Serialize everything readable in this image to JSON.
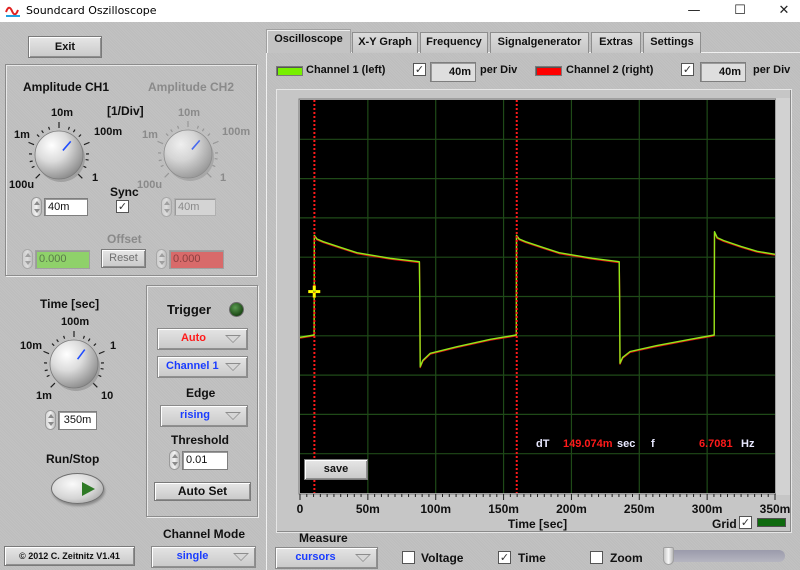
{
  "window": {
    "title": "Soundcard Oszilloscope",
    "minimize_glyph": "—",
    "maximize_glyph": "☐",
    "close_glyph": "✕"
  },
  "left": {
    "exit_label": "Exit",
    "amplitude": {
      "ch1_title": "Amplitude CH1",
      "ch2_title": "Amplitude CH2",
      "unit_label": "[1/Div]",
      "ch1_knob": {
        "scale": [
          "100u",
          "1m",
          "10m",
          "100m",
          "1"
        ],
        "value": "40m",
        "value_num": 0.04,
        "min": 0.0001,
        "max": 1,
        "enabled": true
      },
      "ch2_knob": {
        "scale": [
          "100u",
          "1m",
          "10m",
          "100m",
          "1"
        ],
        "value": "40m",
        "value_num": 0.04,
        "min": 0.0001,
        "max": 1,
        "enabled": false
      },
      "sync_label": "Sync",
      "sync_checked": true,
      "offset_label": "Offset",
      "offset_ch1": "0.000",
      "offset_ch2": "0.000",
      "reset_label": "Reset"
    },
    "time": {
      "title": "Time [sec]",
      "knob": {
        "scale": [
          "1m",
          "10m",
          "100m",
          "1",
          "10"
        ],
        "value": "350m",
        "value_num": 0.35,
        "min": 0.001,
        "max": 10
      }
    },
    "run_stop_label": "Run/Stop",
    "copyright": "© 2012  C. Zeitnitz V1.41",
    "trigger": {
      "title": "Trigger",
      "mode": "Auto",
      "mode_color": "#ff1a1a",
      "source": "Channel 1",
      "source_color": "#1a3cff",
      "edge_label": "Edge",
      "edge": "rising",
      "threshold_label": "Threshold",
      "threshold": "0.01",
      "auto_set_label": "Auto Set",
      "led_state": "off"
    },
    "channel_mode": {
      "label": "Channel Mode",
      "value": "single"
    }
  },
  "tabs": [
    {
      "label": "Oscilloscope",
      "active": true
    },
    {
      "label": "X-Y Graph",
      "active": false
    },
    {
      "label": "Frequency",
      "active": false
    },
    {
      "label": "Signalgenerator",
      "active": false
    },
    {
      "label": "Extras",
      "active": false
    },
    {
      "label": "Settings",
      "active": false
    }
  ],
  "channels": [
    {
      "label": "Channel 1 (left)",
      "color": "#78f000",
      "enabled": true,
      "per_div": "40m"
    },
    {
      "label": "Channel 2 (right)",
      "color": "#ff0000",
      "enabled": true,
      "per_div": "40m"
    }
  ],
  "per_div_label": "per Div",
  "scope": {
    "save_label": "save",
    "dT_label": "dT",
    "dT_value": "149.074m",
    "dT_unit": "sec",
    "f_label": "f",
    "f_value": "6.7081",
    "f_unit": "Hz",
    "grid_label": "Grid",
    "grid_checked": true,
    "grid_color": "#0e6a0e"
  },
  "measure": {
    "label": "Measure",
    "mode": "cursors",
    "voltage_label": "Voltage",
    "voltage_checked": false,
    "time_label": "Time",
    "time_checked": true,
    "zoom_label": "Zoom",
    "zoom_checked": false,
    "zoom_slider_value": 0
  },
  "chart_data": {
    "type": "line",
    "title": "",
    "xlabel": "Time [sec]",
    "ylabel": "",
    "xlim": [
      0,
      0.35
    ],
    "ylim": [
      -0.2,
      0.2
    ],
    "x_divisions": 7,
    "y_divisions": 10,
    "grid": true,
    "grid_color": "#1f4a18",
    "background": "#000000",
    "x_ticks": [
      0,
      0.05,
      0.1,
      0.15,
      0.2,
      0.25,
      0.3,
      0.35
    ],
    "x_tick_labels": [
      "0",
      "50m",
      "100m",
      "150m",
      "200m",
      "250m",
      "300m",
      "350m"
    ],
    "cursors": {
      "type": "time",
      "x": [
        0.0106,
        0.1597
      ],
      "color": "#ff1a1a"
    },
    "trigger_marker": {
      "x": 0.0105,
      "y": 0.005,
      "color": "#ffff00"
    },
    "series": [
      {
        "name": "Channel 2 (right)",
        "color": "#e01010",
        "points": [
          [
            0.0,
            -0.0415
          ],
          [
            0.0104,
            -0.0392
          ],
          [
            0.0105,
            0.0623
          ],
          [
            0.0125,
            0.0585
          ],
          [
            0.0172,
            0.0558
          ],
          [
            0.03,
            0.05
          ],
          [
            0.0419,
            0.0446
          ],
          [
            0.055,
            0.0415
          ],
          [
            0.0665,
            0.0389
          ],
          [
            0.088,
            0.0354
          ],
          [
            0.0883,
            0.001
          ],
          [
            0.0886,
            -0.0714
          ],
          [
            0.0905,
            -0.065
          ],
          [
            0.096,
            -0.0578
          ],
          [
            0.1157,
            -0.0511
          ],
          [
            0.1403,
            -0.0436
          ],
          [
            0.1594,
            -0.0392
          ],
          [
            0.1595,
            0.0623
          ],
          [
            0.1615,
            0.0585
          ],
          [
            0.1662,
            0.0558
          ],
          [
            0.179,
            0.05
          ],
          [
            0.1909,
            0.0446
          ],
          [
            0.204,
            0.0415
          ],
          [
            0.2155,
            0.0389
          ],
          [
            0.2352,
            0.0354
          ],
          [
            0.2355,
            0.001
          ],
          [
            0.2358,
            -0.068
          ],
          [
            0.2377,
            -0.062
          ],
          [
            0.2432,
            -0.056
          ],
          [
            0.2629,
            -0.05
          ],
          [
            0.2875,
            -0.0436
          ],
          [
            0.3052,
            -0.0392
          ],
          [
            0.3054,
            0.066
          ],
          [
            0.3074,
            0.06
          ],
          [
            0.3121,
            0.057
          ],
          [
            0.3249,
            0.051
          ],
          [
            0.3368,
            0.046
          ],
          [
            0.35,
            0.043
          ]
        ]
      },
      {
        "name": "Channel 1 (left)",
        "color": "#8fe81a",
        "points": [
          [
            0.0,
            -0.0415
          ],
          [
            0.0104,
            -0.0392
          ],
          [
            0.0105,
            0.0623
          ],
          [
            0.0125,
            0.0585
          ],
          [
            0.0172,
            0.0558
          ],
          [
            0.03,
            0.05
          ],
          [
            0.0419,
            0.0446
          ],
          [
            0.055,
            0.0415
          ],
          [
            0.0665,
            0.0389
          ],
          [
            0.088,
            0.0354
          ],
          [
            0.0883,
            0.001
          ],
          [
            0.0886,
            -0.0714
          ],
          [
            0.0905,
            -0.065
          ],
          [
            0.096,
            -0.0578
          ],
          [
            0.1157,
            -0.0511
          ],
          [
            0.1403,
            -0.0436
          ],
          [
            0.1594,
            -0.0392
          ],
          [
            0.1595,
            0.0623
          ],
          [
            0.1615,
            0.0585
          ],
          [
            0.1662,
            0.0558
          ],
          [
            0.179,
            0.05
          ],
          [
            0.1909,
            0.0446
          ],
          [
            0.204,
            0.0415
          ],
          [
            0.2155,
            0.0389
          ],
          [
            0.2352,
            0.0354
          ],
          [
            0.2355,
            0.001
          ],
          [
            0.2358,
            -0.068
          ],
          [
            0.2377,
            -0.062
          ],
          [
            0.2432,
            -0.056
          ],
          [
            0.2629,
            -0.05
          ],
          [
            0.2875,
            -0.0436
          ],
          [
            0.3052,
            -0.0392
          ],
          [
            0.3054,
            0.066
          ],
          [
            0.3074,
            0.06
          ],
          [
            0.3121,
            0.057
          ],
          [
            0.3249,
            0.051
          ],
          [
            0.3368,
            0.046
          ],
          [
            0.35,
            0.043
          ]
        ]
      }
    ]
  }
}
